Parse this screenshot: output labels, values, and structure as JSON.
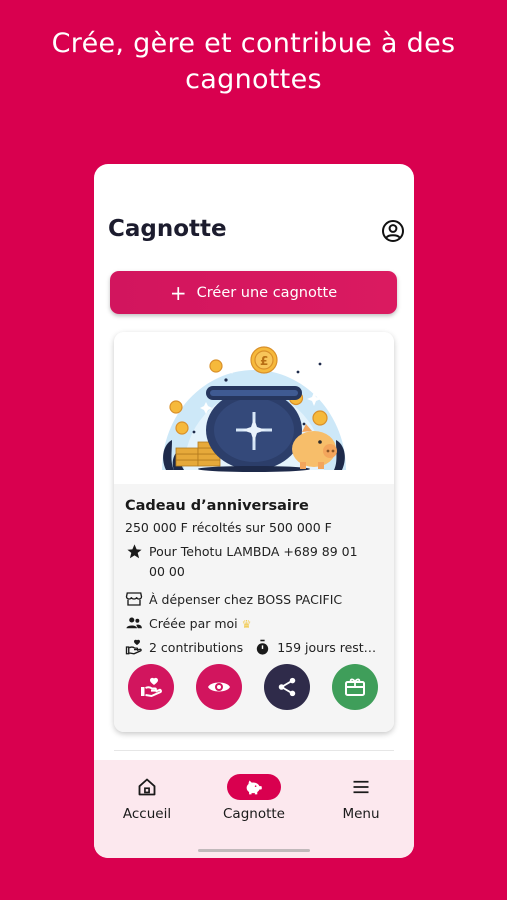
{
  "promo": {
    "headline_line1": "Crée, gère et contribue à des",
    "headline_line2": "cagnottes"
  },
  "header": {
    "title": "Cagnotte",
    "account_icon": "account-circle-icon"
  },
  "create_button": {
    "icon": "plus-icon",
    "label": "Créer une cagnotte"
  },
  "card": {
    "title": "Cadeau d’anniversaire",
    "amount": "250 000 F récoltés sur 500 000 F",
    "beneficiary_line1": "Pour Tehotu LAMBDA +689 89 01",
    "beneficiary_line2": "00 00",
    "shop": "À dépenser chez BOSS PACIFIC",
    "creator": "Créée par moi",
    "contributions": "2 contributions",
    "days_left": "159 jours rest…",
    "icons": {
      "beneficiary": "star-icon",
      "shop": "store-icon",
      "creator": "group-icon",
      "contributions": "volunteer-hand-icon",
      "days": "timer-icon"
    },
    "actions": [
      {
        "name": "contribute",
        "icon": "hand-heart-icon",
        "color": "#D2155E"
      },
      {
        "name": "view",
        "icon": "eye-icon",
        "color": "#D2155E"
      },
      {
        "name": "share",
        "icon": "share-icon",
        "color": "#2F2B4A"
      },
      {
        "name": "gift-card",
        "icon": "gift-card-icon",
        "color": "#3F9E5A"
      }
    ]
  },
  "bottom_nav": {
    "items": [
      {
        "label": "Accueil",
        "icon": "home-icon"
      },
      {
        "label": "Cagnotte",
        "icon": "piggy-bank-icon",
        "active": true
      },
      {
        "label": "Menu",
        "icon": "menu-icon"
      }
    ]
  },
  "colors": {
    "brand": "#D9004F",
    "nav_background": "#FCE8EE",
    "share": "#2F2B4A",
    "gift": "#3F9E5A"
  }
}
